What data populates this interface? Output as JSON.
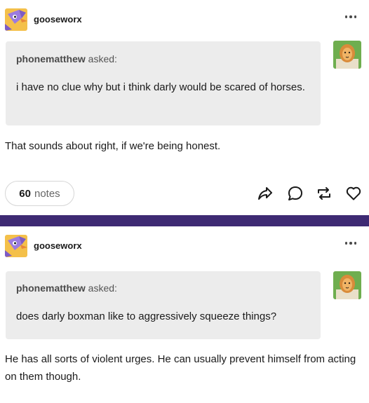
{
  "posts": [
    {
      "blog": {
        "name": "gooseworx",
        "avatar_icon": "goose-avatar-icon"
      },
      "ask": {
        "asker": "phonematthew",
        "asked_label": "asked:",
        "question": "i have no clue why but i think darly would be scared of horses.",
        "asker_avatar_icon": "lion-avatar-icon"
      },
      "answer": "That sounds about right, if we're being honest.",
      "footer": {
        "notes_count": "60",
        "notes_label": "notes",
        "actions": [
          "share-icon",
          "reply-icon",
          "reblog-icon",
          "like-icon"
        ]
      }
    },
    {
      "blog": {
        "name": "gooseworx",
        "avatar_icon": "goose-avatar-icon"
      },
      "ask": {
        "asker": "phonematthew",
        "asked_label": "asked:",
        "question": "does darly boxman like to aggressively squeeze things?",
        "asker_avatar_icon": "lion-avatar-icon"
      },
      "answer": "He has all sorts of violent urges. He can usually prevent himself from acting on them though."
    }
  ],
  "colors": {
    "divider": "#3e2a73",
    "ask_bubble": "#ececec",
    "avatar_bg": "#f4c04a",
    "avatar_accent": "#7d5bc4",
    "asker_avatar_bg": "#6fae4f"
  }
}
